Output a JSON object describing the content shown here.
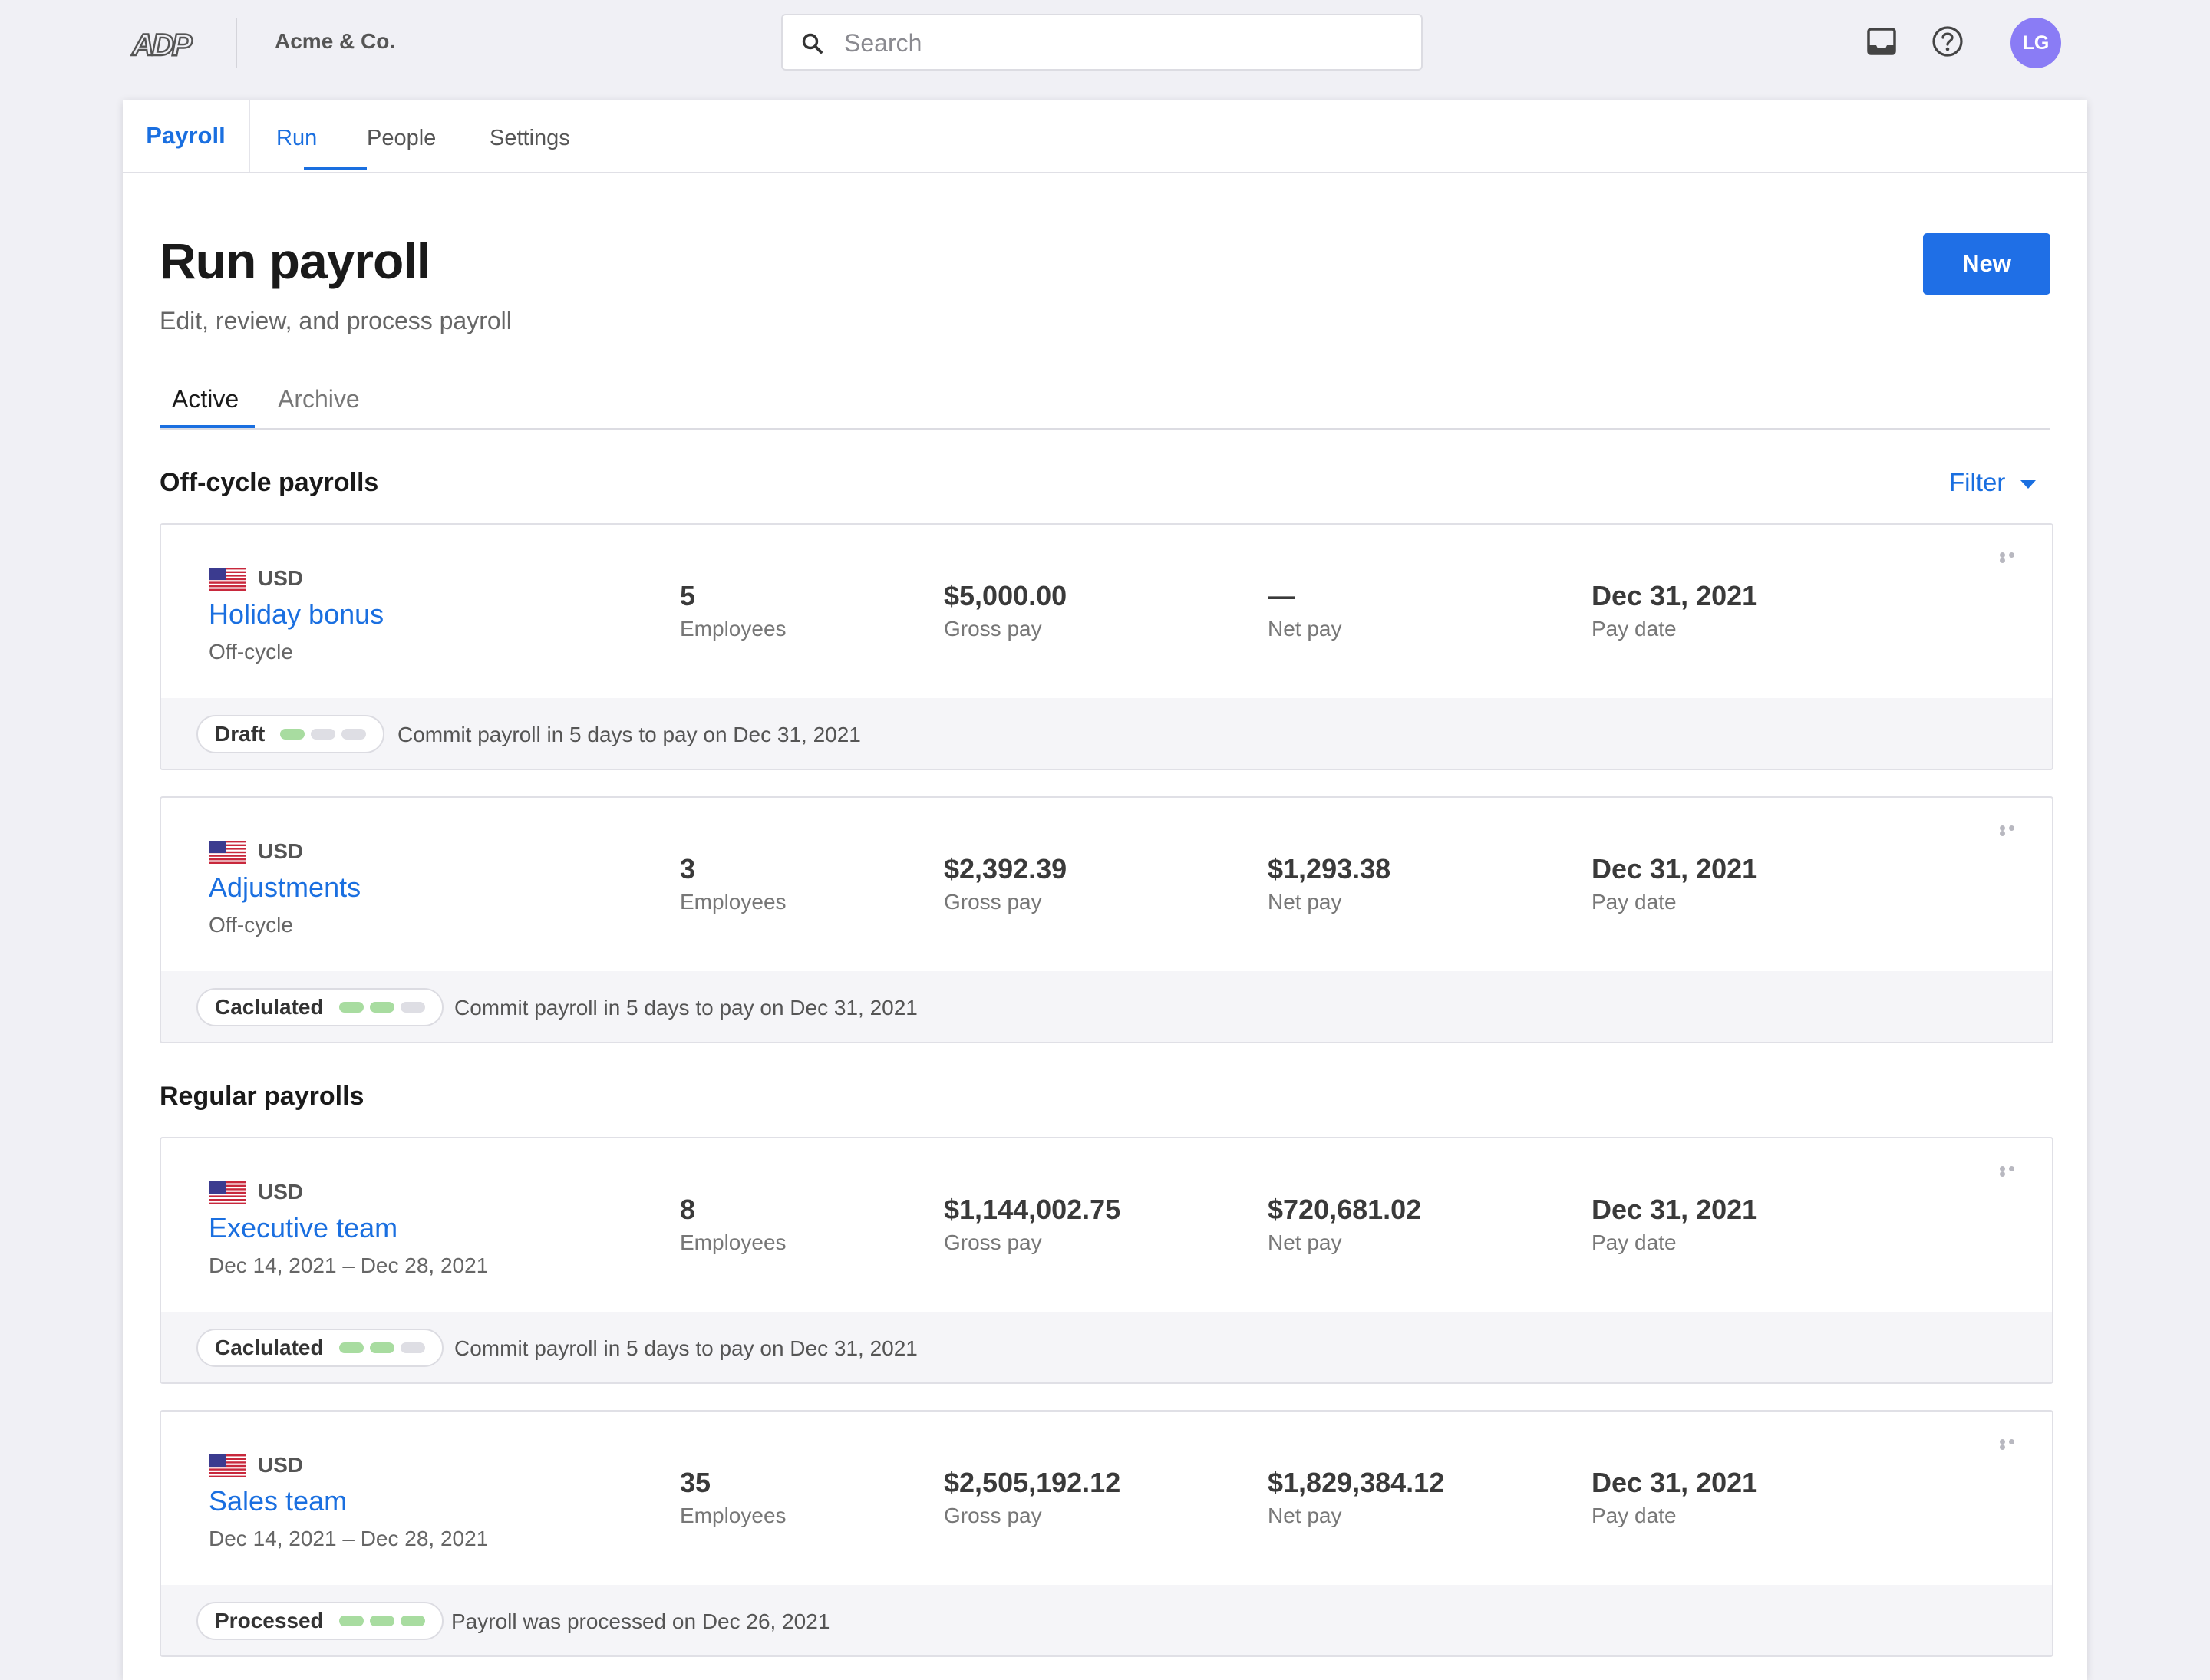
{
  "header": {
    "logo_text": "ADP",
    "company": "Acme & Co.",
    "search_placeholder": "Search",
    "avatar_initials": "LG"
  },
  "app_nav": {
    "app_label": "Payroll",
    "links": [
      "Run",
      "People",
      "Settings"
    ],
    "active_link": "Run"
  },
  "page": {
    "title": "Run payroll",
    "subtitle": "Edit, review, and process payroll",
    "new_button": "New",
    "tabs": [
      "Active",
      "Archive"
    ],
    "active_tab": "Active",
    "filter_label": "Filter"
  },
  "metric_labels": {
    "employees": "Employees",
    "gross": "Gross pay",
    "net": "Net pay",
    "date": "Pay date"
  },
  "sections": [
    {
      "title": "Off-cycle payrolls",
      "cards": [
        {
          "currency": "USD",
          "name": "Holiday bonus",
          "type": "Off-cycle",
          "employees": "5",
          "gross": "$5,000.00",
          "net": "—",
          "date": "Dec 31, 2021",
          "status": "Draft",
          "steps_done": 1,
          "message": "Commit payroll in 5 days to pay on Dec 31, 2021"
        },
        {
          "currency": "USD",
          "name": "Adjustments",
          "type": "Off-cycle",
          "employees": "3",
          "gross": "$2,392.39",
          "net": "$1,293.38",
          "date": "Dec 31, 2021",
          "status": "Caclulated",
          "steps_done": 2,
          "message": "Commit payroll in 5 days to pay on Dec 31, 2021"
        }
      ]
    },
    {
      "title": "Regular payrolls",
      "cards": [
        {
          "currency": "USD",
          "name": "Executive team",
          "type": "Dec 14, 2021 – Dec 28, 2021",
          "employees": "8",
          "gross": "$1,144,002.75",
          "net": "$720,681.02",
          "date": "Dec 31, 2021",
          "status": "Caclulated",
          "steps_done": 2,
          "message": "Commit payroll in 5 days to pay on Dec 31, 2021"
        },
        {
          "currency": "USD",
          "name": "Sales team",
          "type": "Dec 14, 2021 – Dec 28, 2021",
          "employees": "35",
          "gross": "$2,505,192.12",
          "net": "$1,829,384.12",
          "date": "Dec 31, 2021",
          "status": "Processed",
          "steps_done": 3,
          "message": "Payroll was processed on Dec 26, 2021"
        }
      ]
    }
  ],
  "colors": {
    "accent": "#1f6fe6",
    "step_done": "#a8dca0",
    "step_todo": "#dedee4",
    "avatar": "#8a7cf5"
  }
}
